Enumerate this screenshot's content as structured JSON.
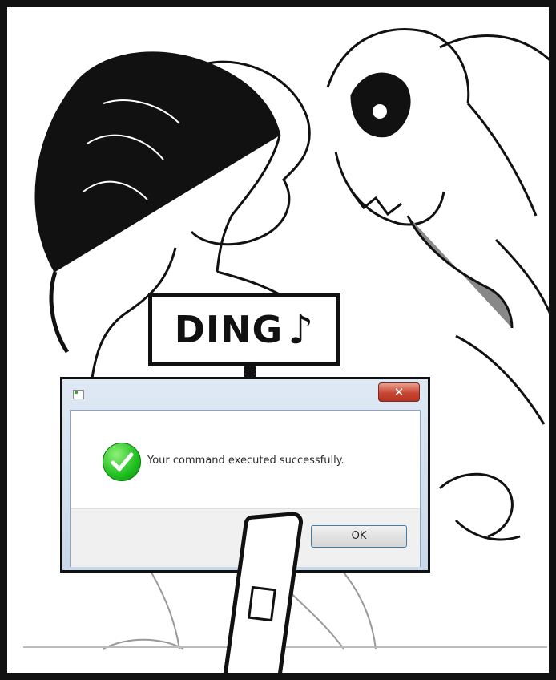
{
  "sign": {
    "text": "DING",
    "note_glyph": "♪"
  },
  "dialog": {
    "title": "",
    "close_glyph": "✕",
    "icon": "success-check-icon",
    "message": "Your command executed successfully.",
    "ok_label": "OK",
    "colors": {
      "close_button": "#c74532",
      "success": "#1fbf1f",
      "ok_border": "#3c7fb1"
    }
  }
}
